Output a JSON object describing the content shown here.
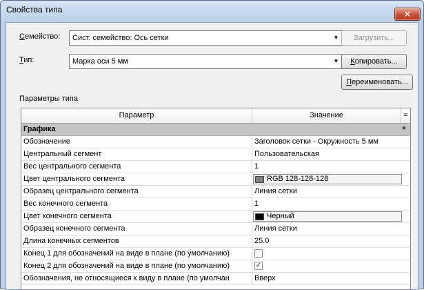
{
  "window": {
    "title": "Свойства типа",
    "close_glyph": "✕"
  },
  "family": {
    "label": "Семейство:",
    "mnemonic": "С",
    "label_rest": "емейство:",
    "value": "Сист. семейство: Ось сетки",
    "load_button": "Загрузить..."
  },
  "type": {
    "label": "Тип:",
    "mnemonic": "Т",
    "label_rest": "ип:",
    "value": "Марка оси 5 мм",
    "copy_button": "Копировать...",
    "copy_mnemonic": "К",
    "copy_rest": "опировать...",
    "rename_button": "Переименовать...",
    "rename_mnemonic": "П",
    "rename_rest": "ереименовать..."
  },
  "params": {
    "title": "Параметры типа",
    "col_param": "Параметр",
    "col_value": "Значение",
    "col_sort": "=",
    "section": "Графика",
    "section_toggle": "»",
    "rows": [
      {
        "param": "Обозначение",
        "value": "Заголовок сетки - Окружность 5 мм"
      },
      {
        "param": "Центральный сегмент",
        "value": "Пользовательская"
      },
      {
        "param": "Вес центрального сегмента",
        "value": "1"
      },
      {
        "param": "Цвет центрального сегмента",
        "value": "RGB 128-128-128",
        "swatch": "#808080"
      },
      {
        "param": "Образец центрального сегмента",
        "value": "Линия сетки"
      },
      {
        "param": "Вес конечного сегмента",
        "value": "1"
      },
      {
        "param": "Цвет конечного сегмента",
        "value": "Черный",
        "swatch": "#000000"
      },
      {
        "param": "Образец конечного сегмента",
        "value": "Линия сетки"
      },
      {
        "param": "Длина конечных сегментов",
        "value": "25.0"
      },
      {
        "param": "Конец 1 для обозначений на виде в плане (по умолчанию)",
        "checked": false
      },
      {
        "param": "Конец 2 для обозначений на виде в плане (по умолчанию)",
        "checked": true
      },
      {
        "param": "Обозначения, не относящиеся к виду в плане (по умолчан",
        "value": "Вверх"
      }
    ]
  },
  "colors": {
    "title_bg": "#bcd1ea",
    "close_red": "#c7503a",
    "section_bg": "#c4c4c4"
  }
}
